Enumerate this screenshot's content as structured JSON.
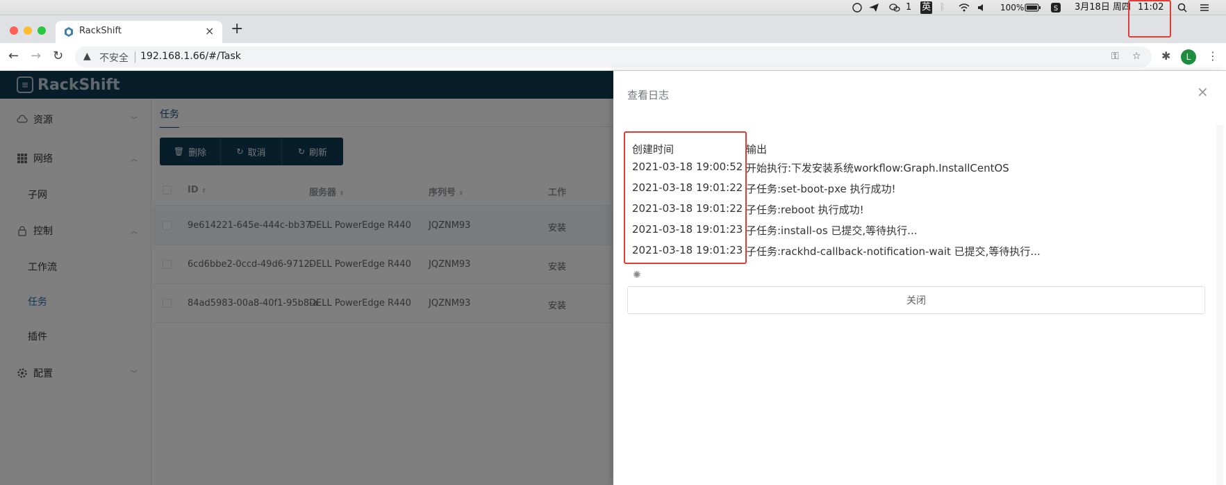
{
  "menubar": {
    "wechat_badge": "1",
    "ime": "英",
    "battery": "100%",
    "date": "3月18日 周四",
    "time": "11:02"
  },
  "browser": {
    "tab_title": "RackShift",
    "close_glyph": "×",
    "new_tab_glyph": "+",
    "insecure_label": "不安全",
    "url": "192.168.1.66/#/Task",
    "avatar_letter": "L"
  },
  "app": {
    "logo_text": "RackShift"
  },
  "sidebar": {
    "items": [
      {
        "label": "资源"
      },
      {
        "label": "网络"
      },
      {
        "label": "子网"
      },
      {
        "label": "控制"
      },
      {
        "label": "工作流"
      },
      {
        "label": "任务"
      },
      {
        "label": "插件"
      },
      {
        "label": "配置"
      }
    ]
  },
  "main": {
    "tab": "任务",
    "buttons": {
      "delete": "删除",
      "cancel": "取消",
      "refresh": "刷新"
    },
    "columns": [
      "ID",
      "服务器",
      "序列号",
      "工作"
    ],
    "rows": [
      {
        "id": "9e614221-645e-444c-bb37-",
        "server": "DELL PowerEdge R440",
        "serial": "JQZNM93",
        "status": "安装"
      },
      {
        "id": "6cd6bbe2-0ccd-49d6-9712-",
        "server": "DELL PowerEdge R440",
        "serial": "JQZNM93",
        "status": "安装"
      },
      {
        "id": "84ad5983-00a8-40f1-95b8-a",
        "server": "DELL PowerEdge R440",
        "serial": "JQZNM93",
        "status": "安装"
      }
    ]
  },
  "drawer": {
    "title": "查看日志",
    "close_glyph": "×",
    "header_time": "创建时间",
    "header_output": "输出",
    "logs": [
      {
        "time": "2021-03-18 19:00:52",
        "output": "开始执行:下发安装系统workflow:Graph.InstallCentOS"
      },
      {
        "time": "2021-03-18 19:01:22",
        "output": "子任务:set-boot-pxe 执行成功!"
      },
      {
        "time": "2021-03-18 19:01:22",
        "output": "子任务:reboot 执行成功!"
      },
      {
        "time": "2021-03-18 19:01:23",
        "output": "子任务:install-os 已提交,等待执行..."
      },
      {
        "time": "2021-03-18 19:01:23",
        "output": "子任务:rackhd-callback-notification-wait 已提交,等待执行..."
      }
    ],
    "close_button": "关闭"
  },
  "colors": {
    "header_bg": "#0e3a55",
    "highlight": "#e23b34",
    "active_link": "#1e6fa8"
  }
}
